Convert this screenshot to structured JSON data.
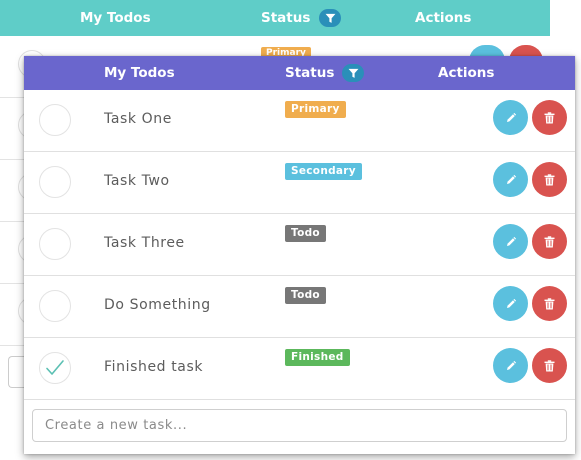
{
  "background_table": {
    "header": {
      "col_todos": "My Todos",
      "col_status": "Status",
      "col_actions": "Actions",
      "filter_icon": "filter-icon"
    },
    "first_row_badge": "Primary",
    "colors": {
      "header": "#5fcdc8"
    }
  },
  "table": {
    "header": {
      "col_todos": "My Todos",
      "col_status": "Status",
      "col_actions": "Actions",
      "filter_icon": "filter-icon"
    },
    "colors": {
      "header": "#6a66cd",
      "edit": "#5bc0de",
      "delete": "#d9534f"
    },
    "rows": [
      {
        "task": "Task One",
        "status": "Primary",
        "status_color": "#f0ad4e",
        "done": false,
        "edit_icon": "pencil-icon",
        "delete_icon": "trash-icon"
      },
      {
        "task": "Task Two",
        "status": "Secondary",
        "status_color": "#5bc0de",
        "done": false,
        "edit_icon": "pencil-icon",
        "delete_icon": "trash-icon"
      },
      {
        "task": "Task Three",
        "status": "Todo",
        "status_color": "#777777",
        "done": false,
        "edit_icon": "pencil-icon",
        "delete_icon": "trash-icon"
      },
      {
        "task": "Do Something",
        "status": "Todo",
        "status_color": "#777777",
        "done": false,
        "edit_icon": "pencil-icon",
        "delete_icon": "trash-icon"
      },
      {
        "task": "Finished task",
        "status": "Finished",
        "status_color": "#5cb85c",
        "done": true,
        "edit_icon": "pencil-icon",
        "delete_icon": "trash-icon"
      }
    ],
    "new_task": {
      "value": "",
      "placeholder": "Create a new task..."
    }
  }
}
